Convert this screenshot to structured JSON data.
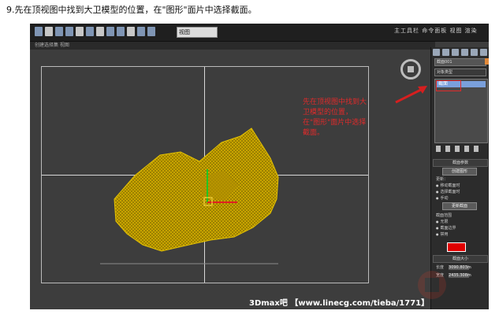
{
  "caption": "9.先在顶视图中找到大卫模型的位置，在\"图形\"面片中选择截面。",
  "toolbar": {
    "select_value": "视图",
    "right_text": "主工具栏 命令面板 视图 渲染"
  },
  "subbar": {
    "text": "创建选择集     视图"
  },
  "annotation": "先在顶视图中找到大卫模型的位置，在\"图形\"面片中选择截面。",
  "panel": {
    "name_field": "截面001",
    "dropdown": "对象类型",
    "list_selected": "截面",
    "rollout_params": "截面参数",
    "create_shape_button": "创建图形",
    "update_label": "更新：",
    "radio_move": "移动截面时",
    "radio_select": "选择截面时",
    "radio_manual": "手动",
    "update_button": "更新截面",
    "extent_label": "截面范围",
    "radio_infinite": "无限",
    "radio_boundary": "截面边界",
    "radio_disabled": "禁用",
    "rollout_size": "截面大小",
    "length_label": "长度",
    "length_value": "3090.803m",
    "width_label": "宽度",
    "width_value": "2435.308m"
  },
  "watermark": "3Dmax吧 【www.linecg.com/tieba/1771】",
  "colors": {
    "section_color": "#e00000",
    "mesh_color": "#c8a400",
    "annotation_red": "#e02a2a"
  }
}
